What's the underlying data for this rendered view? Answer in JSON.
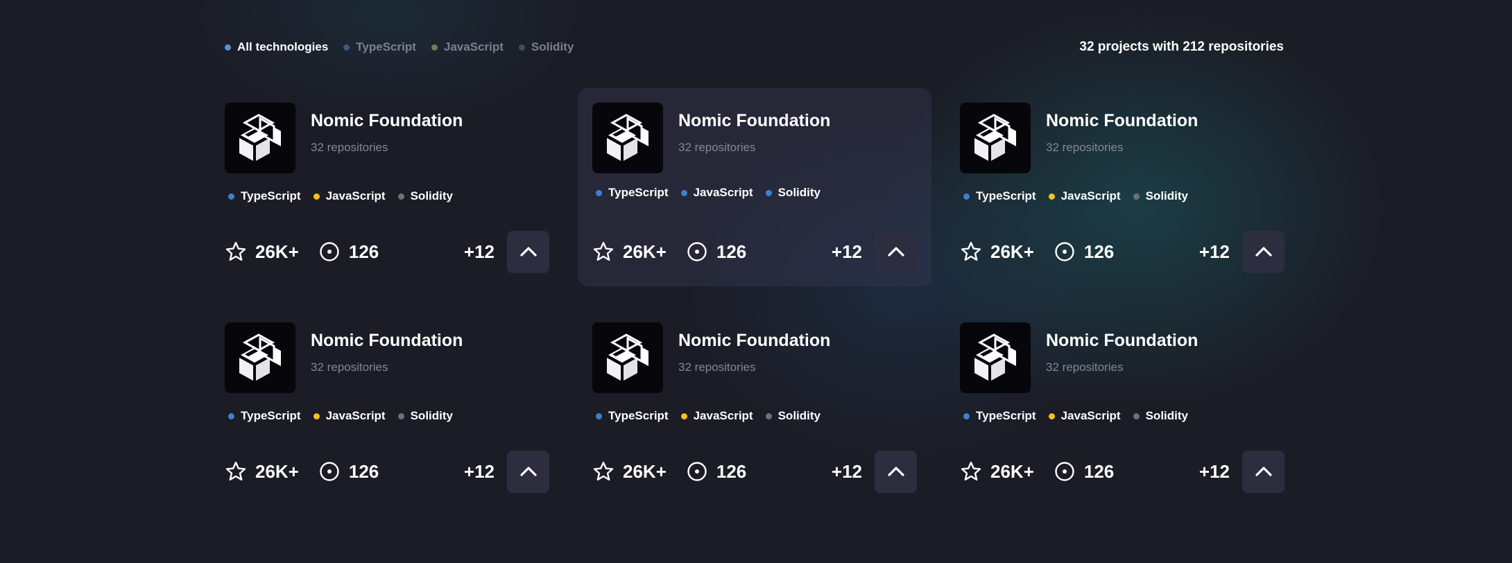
{
  "colors": {
    "typescript": "#3f7fd3",
    "javascript": "#f1c21b",
    "solidity": "#6e7080",
    "all": "#5b8ed6",
    "filter_typescript": "#3a5a86",
    "filter_javascript": "#7a7760",
    "filter_solidity": "#4a4c58",
    "highlight_solidity": "#3f7fd3"
  },
  "filters": [
    {
      "label": "All technologies",
      "active": true
    },
    {
      "label": "TypeScript",
      "active": false
    },
    {
      "label": "JavaScript",
      "active": false
    },
    {
      "label": "Solidity",
      "active": false
    }
  ],
  "summary": "32 projects with 212 repositories",
  "cards": [
    {
      "logo_icon": "cube-icon",
      "name": "Nomic Foundation",
      "repos": "32 repositories",
      "technologies": [
        "TypeScript",
        "JavaScript",
        "Solidity"
      ],
      "stars": "26K+",
      "issues": "126",
      "more": "+12",
      "highlighted": false
    },
    {
      "logo_icon": "cube-icon",
      "name": "Nomic Foundation",
      "repos": "32 repositories",
      "technologies": [
        "TypeScript",
        "JavaScript",
        "Solidity"
      ],
      "stars": "26K+",
      "issues": "126",
      "more": "+12",
      "highlighted": true
    },
    {
      "logo_icon": "cube-icon",
      "name": "Nomic Foundation",
      "repos": "32 repositories",
      "technologies": [
        "TypeScript",
        "JavaScript",
        "Solidity"
      ],
      "stars": "26K+",
      "issues": "126",
      "more": "+12",
      "highlighted": false
    },
    {
      "logo_icon": "cube-icon",
      "name": "Nomic Foundation",
      "repos": "32 repositories",
      "technologies": [
        "TypeScript",
        "JavaScript",
        "Solidity"
      ],
      "stars": "26K+",
      "issues": "126",
      "more": "+12",
      "highlighted": false
    },
    {
      "logo_icon": "cube-icon",
      "name": "Nomic Foundation",
      "repos": "32 repositories",
      "technologies": [
        "TypeScript",
        "JavaScript",
        "Solidity"
      ],
      "stars": "26K+",
      "issues": "126",
      "more": "+12",
      "highlighted": false
    },
    {
      "logo_icon": "cube-icon",
      "name": "Nomic Foundation",
      "repos": "32 repositories",
      "technologies": [
        "TypeScript",
        "JavaScript",
        "Solidity"
      ],
      "stars": "26K+",
      "issues": "126",
      "more": "+12",
      "highlighted": false
    }
  ]
}
